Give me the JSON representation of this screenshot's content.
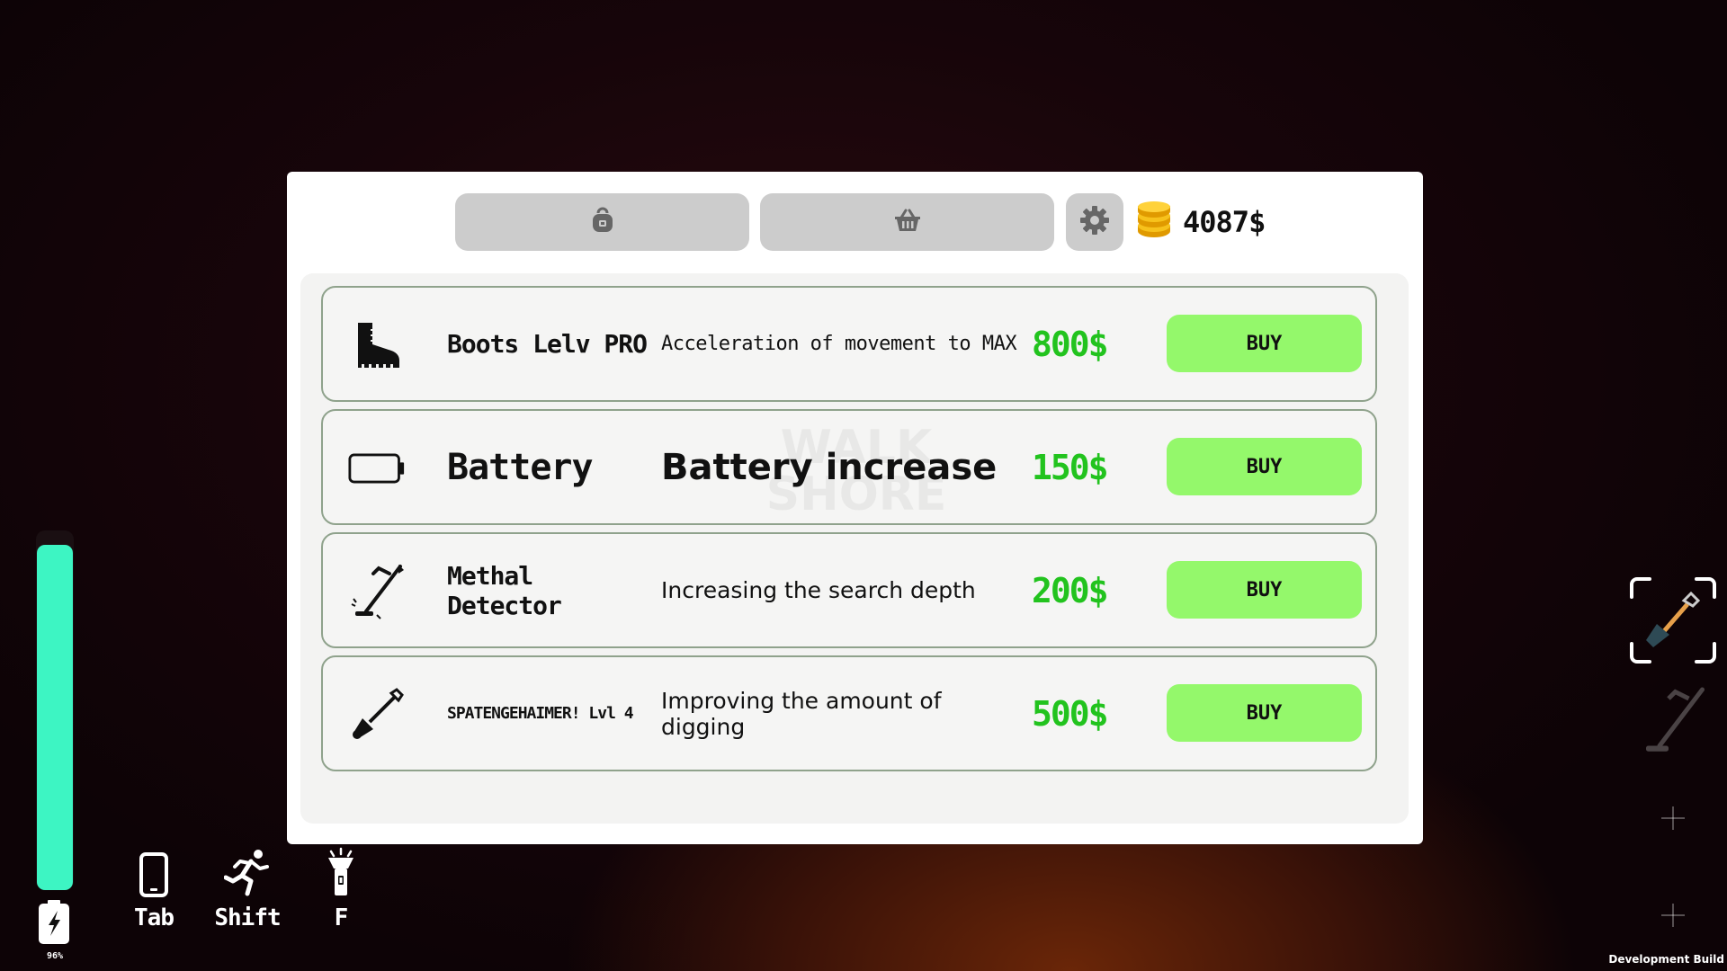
{
  "shop": {
    "tabs": [
      {
        "icon": "backpack-icon"
      },
      {
        "icon": "basket-icon"
      }
    ],
    "settings_icon": "gear-icon",
    "coins_icon": "coins-icon",
    "money": "4087$",
    "watermark": [
      "WALK",
      "SHORE"
    ],
    "buy_label": "BUY",
    "items": [
      {
        "icon": "boot-icon",
        "name": "Boots Lelv PRO",
        "description": "Acceleration of movement to MAX",
        "price": "800$",
        "buy": "BUY"
      },
      {
        "icon": "battery-icon",
        "name": "Battery",
        "description": "Battery increase",
        "price": "150$",
        "buy": "BUY"
      },
      {
        "icon": "metal-detector-icon",
        "name": "Methal Detector",
        "description": "Increasing the search depth",
        "price": "200$",
        "buy": "BUY"
      },
      {
        "icon": "shovel-icon",
        "name": "SPATENGEHAIMER! Lvl 4",
        "description": "Improving the amount of digging",
        "price": "500$",
        "buy": "BUY"
      }
    ]
  },
  "hud": {
    "stamina_level": 0.96,
    "battery_percent": "96%",
    "colors": {
      "stamina": "#3df5c3",
      "price": "#22c31e",
      "buy_button": "#94f86b"
    },
    "hints": [
      {
        "icon": "phone-icon",
        "key": "Tab"
      },
      {
        "icon": "running-icon",
        "key": "Shift"
      },
      {
        "icon": "flashlight-icon",
        "key": "F"
      }
    ],
    "inventory": [
      {
        "icon": "shovel-icon",
        "selected": true
      },
      {
        "icon": "metal-detector-icon",
        "selected": false
      },
      {
        "icon": "plus-icon",
        "selected": false
      },
      {
        "icon": "plus-icon",
        "selected": false
      }
    ],
    "dev_build": "Development Build"
  }
}
